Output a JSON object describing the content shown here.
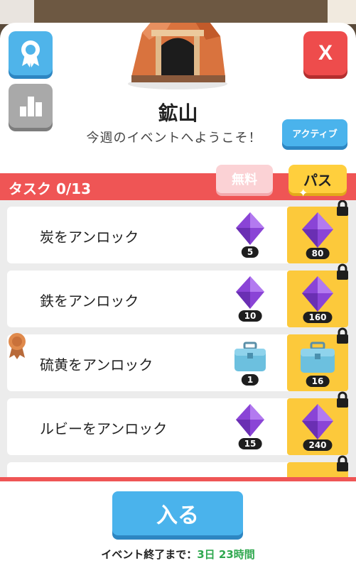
{
  "header": {
    "title": "鉱山",
    "subtitle": "今週のイベントへようこそ！",
    "active_label": "アクティブ",
    "close_label": "X"
  },
  "tasks": {
    "label": "タスク 0/13",
    "free_tab": "無料",
    "pass_tab": "パス",
    "items": [
      {
        "name": "炭をアンロック",
        "free_reward_icon": "purple-gem-icon",
        "free_count": "5",
        "pass_reward_icon": "purple-gem-icon",
        "pass_count": "80",
        "locked": true
      },
      {
        "name": "鉄をアンロック",
        "free_reward_icon": "purple-gem-icon",
        "free_count": "10",
        "pass_reward_icon": "purple-gem-icon",
        "pass_count": "160",
        "locked": true
      },
      {
        "name": "硫黄をアンロック",
        "free_reward_icon": "toolbox-icon",
        "free_count": "1",
        "pass_reward_icon": "toolbox-icon",
        "pass_count": "16",
        "locked": true
      },
      {
        "name": "ルビーをアンロック",
        "free_reward_icon": "purple-gem-icon",
        "free_count": "15",
        "pass_reward_icon": "purple-gem-icon",
        "pass_count": "240",
        "locked": true
      }
    ]
  },
  "footer": {
    "enter_label": "入る",
    "ends_prefix": "イベント終了まで：",
    "ends_time": "3日 23時間"
  },
  "colors": {
    "accent_blue": "#4ab3ec",
    "task_red": "#ef5555",
    "pass_yellow": "#fcc93b",
    "time_green": "#2fa84f"
  }
}
